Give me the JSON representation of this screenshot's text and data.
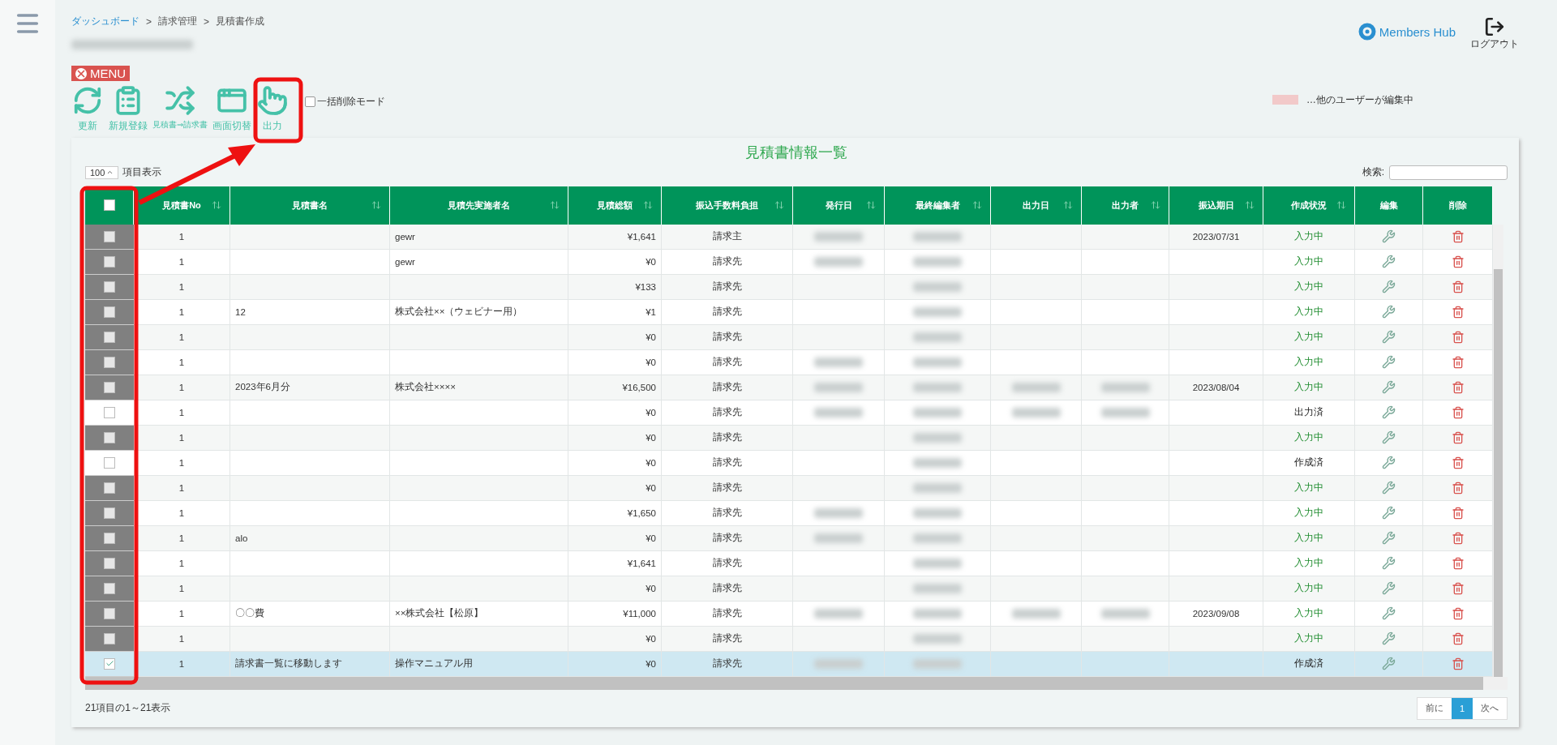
{
  "breadcrumb": [
    {
      "label": "ダッシュボード",
      "link": true
    },
    {
      "label": "請求管理",
      "link": false,
      "separator": ">"
    },
    {
      "label": "見積書作成",
      "link": false,
      "separator": ">"
    }
  ],
  "header": {
    "logo": "Members Hub",
    "logout": "ログアウト"
  },
  "menu_badge": "MENU",
  "toolbar": [
    {
      "label": "更新",
      "kind": "refresh",
      "small": false
    },
    {
      "label": "新規登録",
      "kind": "new",
      "small": false
    },
    {
      "label": "見積書⇒請求書",
      "kind": "convert",
      "small": true
    },
    {
      "label": "画面切替",
      "kind": "switch",
      "small": false
    },
    {
      "label": "出力",
      "kind": "output",
      "small": false
    }
  ],
  "bulk_delete": {
    "label": "一括削除モード",
    "checked": false
  },
  "legend": {
    "label": "…他のユーザーが編集中",
    "color": "#f2c9c9"
  },
  "card_title": "見積書情報一覧",
  "page_length": {
    "value": "100",
    "label": "項目表示"
  },
  "search": {
    "label": "検索:"
  },
  "columns": [
    {
      "sortable": false
    },
    {
      "label": "見積書No",
      "sortable": true
    },
    {
      "label": "見積書名",
      "sortable": true
    },
    {
      "label": "見積先実施者名",
      "sortable": true
    },
    {
      "label": "見積総額",
      "sortable": true
    },
    {
      "label": "振込手数料負担",
      "sortable": true
    },
    {
      "label": "発行日",
      "sortable": true
    },
    {
      "label": "最終編集者",
      "sortable": true
    },
    {
      "label": "出力日",
      "sortable": true
    },
    {
      "label": "出力者",
      "sortable": true
    },
    {
      "label": "振込期日",
      "sortable": true
    },
    {
      "label": "作成状況",
      "sortable": true
    },
    {
      "label": "編集",
      "sortable": false
    },
    {
      "label": "削除",
      "sortable": false
    }
  ],
  "rows": [
    {
      "disabled": true,
      "checked": false,
      "selected": false,
      "no": "1",
      "client": "gewr",
      "amount": "¥1,641",
      "fee": "請求主",
      "issue_date_blurred": true,
      "editor_blurred": true,
      "output_date_blurred": false,
      "output_by_blurred": false,
      "due": "2023/07/31",
      "status": "入力中",
      "in_progress": true
    },
    {
      "disabled": true,
      "checked": false,
      "selected": false,
      "no": "1",
      "client": "gewr",
      "amount": "¥0",
      "fee": "請求先",
      "issue_date_blurred": true,
      "editor_blurred": true,
      "output_date_blurred": false,
      "output_by_blurred": false,
      "status": "入力中",
      "in_progress": true
    },
    {
      "disabled": true,
      "checked": false,
      "selected": false,
      "no": "1",
      "amount": "¥133",
      "fee": "請求先",
      "issue_date_blurred": false,
      "editor_blurred": true,
      "output_date_blurred": false,
      "output_by_blurred": false,
      "status": "入力中",
      "in_progress": true
    },
    {
      "disabled": true,
      "checked": false,
      "selected": false,
      "no": "1",
      "name": "12",
      "client": "株式会社××（ウェビナー用）",
      "amount": "¥1",
      "fee": "請求先",
      "issue_date_blurred": false,
      "editor_blurred": true,
      "output_date_blurred": false,
      "output_by_blurred": false,
      "status": "入力中",
      "in_progress": true
    },
    {
      "disabled": true,
      "checked": false,
      "selected": false,
      "no": "1",
      "amount": "¥0",
      "fee": "請求先",
      "issue_date_blurred": false,
      "editor_blurred": true,
      "output_date_blurred": false,
      "output_by_blurred": false,
      "status": "入力中",
      "in_progress": true
    },
    {
      "disabled": true,
      "checked": false,
      "selected": false,
      "no": "1",
      "amount": "¥0",
      "fee": "請求先",
      "issue_date_blurred": true,
      "editor_blurred": true,
      "output_date_blurred": false,
      "output_by_blurred": false,
      "status": "入力中",
      "in_progress": true
    },
    {
      "disabled": true,
      "checked": false,
      "selected": false,
      "no": "1",
      "name": "2023年6月分",
      "client": "株式会社××××",
      "amount": "¥16,500",
      "fee": "請求先",
      "issue_date_blurred": true,
      "editor_blurred": true,
      "output_date_blurred": true,
      "output_by_blurred": true,
      "due": "2023/08/04",
      "status": "入力中",
      "in_progress": true
    },
    {
      "disabled": false,
      "checked": false,
      "selected": false,
      "no": "1",
      "amount": "¥0",
      "fee": "請求先",
      "issue_date_blurred": true,
      "editor_blurred": true,
      "output_date_blurred": true,
      "output_by_blurred": true,
      "status": "出力済",
      "in_progress": false
    },
    {
      "disabled": true,
      "checked": false,
      "selected": false,
      "no": "1",
      "amount": "¥0",
      "fee": "請求先",
      "issue_date_blurred": false,
      "editor_blurred": true,
      "output_date_blurred": false,
      "output_by_blurred": false,
      "status": "入力中",
      "in_progress": true
    },
    {
      "disabled": false,
      "checked": false,
      "selected": false,
      "no": "1",
      "amount": "¥0",
      "fee": "請求先",
      "issue_date_blurred": false,
      "editor_blurred": true,
      "output_date_blurred": false,
      "output_by_blurred": false,
      "status": "作成済",
      "in_progress": false
    },
    {
      "disabled": true,
      "checked": false,
      "selected": false,
      "no": "1",
      "amount": "¥0",
      "fee": "請求先",
      "issue_date_blurred": false,
      "editor_blurred": true,
      "output_date_blurred": false,
      "output_by_blurred": false,
      "status": "入力中",
      "in_progress": true
    },
    {
      "disabled": true,
      "checked": false,
      "selected": false,
      "no": "1",
      "amount": "¥1,650",
      "fee": "請求先",
      "issue_date_blurred": true,
      "editor_blurred": true,
      "output_date_blurred": false,
      "output_by_blurred": false,
      "status": "入力中",
      "in_progress": true
    },
    {
      "disabled": true,
      "checked": false,
      "selected": false,
      "no": "1",
      "name": "alo",
      "amount": "¥0",
      "fee": "請求先",
      "issue_date_blurred": true,
      "editor_blurred": true,
      "output_date_blurred": false,
      "output_by_blurred": false,
      "status": "入力中",
      "in_progress": true
    },
    {
      "disabled": true,
      "checked": false,
      "selected": false,
      "no": "1",
      "amount": "¥1,641",
      "fee": "請求先",
      "issue_date_blurred": false,
      "editor_blurred": true,
      "output_date_blurred": false,
      "output_by_blurred": false,
      "status": "入力中",
      "in_progress": true
    },
    {
      "disabled": true,
      "checked": false,
      "selected": false,
      "no": "1",
      "amount": "¥0",
      "fee": "請求先",
      "issue_date_blurred": false,
      "editor_blurred": true,
      "output_date_blurred": false,
      "output_by_blurred": false,
      "status": "入力中",
      "in_progress": true
    },
    {
      "disabled": true,
      "checked": false,
      "selected": false,
      "no": "1",
      "name": "〇〇費",
      "client": "××株式会社【松原】",
      "amount": "¥11,000",
      "fee": "請求先",
      "issue_date_blurred": true,
      "editor_blurred": true,
      "output_date_blurred": true,
      "output_by_blurred": true,
      "due": "2023/09/08",
      "status": "入力中",
      "in_progress": true
    },
    {
      "disabled": true,
      "checked": false,
      "selected": false,
      "no": "1",
      "amount": "¥0",
      "fee": "請求先",
      "issue_date_blurred": false,
      "editor_blurred": true,
      "output_date_blurred": false,
      "output_by_blurred": false,
      "status": "入力中",
      "in_progress": true
    },
    {
      "disabled": false,
      "checked": true,
      "selected": true,
      "no": "1",
      "name": "請求書一覧に移動します",
      "client": "操作マニュアル用",
      "amount": "¥0",
      "fee": "請求先",
      "issue_date_blurred": true,
      "editor_blurred": true,
      "output_date_blurred": false,
      "output_by_blurred": false,
      "status": "作成済",
      "in_progress": false
    }
  ],
  "footer_info": "21項目の1～21表示",
  "pagination": [
    {
      "label": "前に",
      "selected": false
    },
    {
      "label": "1",
      "selected": true
    },
    {
      "label": "次へ",
      "selected": false
    }
  ]
}
